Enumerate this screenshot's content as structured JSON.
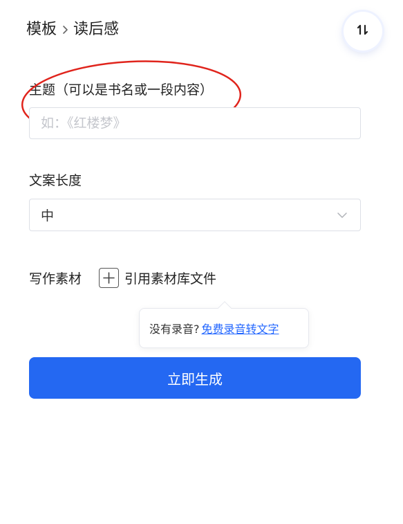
{
  "breadcrumb": {
    "parent": "模板",
    "current": "读后感"
  },
  "topic": {
    "label": "主题（可以是书名或一段内容）",
    "placeholder": "如：《红楼梦》",
    "value": ""
  },
  "length": {
    "label": "文案长度",
    "selected": "中"
  },
  "materials": {
    "label": "写作素材",
    "cite_label": "引用素材库文件"
  },
  "tooltip": {
    "text": "没有录音?",
    "link": "免费录音转文字"
  },
  "generate_label": "立即生成",
  "icons": {
    "breadcrumb_sep": "chevron-right-icon",
    "swap": "swap-vertical-icon",
    "dropdown": "chevron-down-icon",
    "plus": "plus-icon"
  },
  "colors": {
    "primary": "#2468f2",
    "link": "#2266ff",
    "annotation": "#e0241c"
  }
}
